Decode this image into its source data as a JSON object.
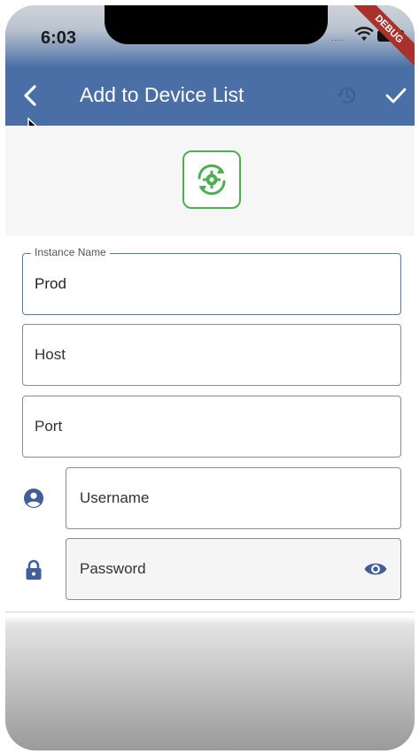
{
  "status_bar": {
    "time": "6:03",
    "dots": "....",
    "debug_label": "DEBUG"
  },
  "app_bar": {
    "title": "Add to Device List",
    "back_icon": "chevron-left-icon",
    "history_icon": "history-icon",
    "confirm_icon": "check-icon",
    "color": "#4a6fa6"
  },
  "logo": {
    "icon": "settings-sync-icon",
    "color": "#4caf50"
  },
  "form": {
    "instance_name": {
      "label": "Instance Name",
      "value": "Prod"
    },
    "host": {
      "placeholder": "Host"
    },
    "port": {
      "placeholder": "Port"
    },
    "username": {
      "placeholder": "Username",
      "icon": "account-circle-icon"
    },
    "password": {
      "placeholder": "Password",
      "icon": "lock-icon",
      "toggle_icon": "eye-icon"
    },
    "icon_color": "#3f5f96"
  }
}
